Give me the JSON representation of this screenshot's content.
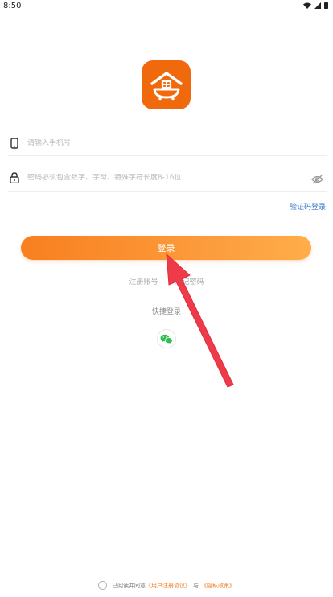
{
  "status_bar": {
    "time": "8:50"
  },
  "form": {
    "phone_placeholder": "请输入手机号",
    "password_placeholder": "密码必须包含数字、字母、特殊字符长度8-16位",
    "sms_login_link": "验证码登录",
    "login_button": "登录",
    "register_link": "注册账号",
    "forgot_password_link": "忘记密码"
  },
  "quick_login": {
    "label": "快捷登录",
    "icon": "wechat-icon"
  },
  "agreement": {
    "prefix": "已阅读并同意",
    "user_agreement": "《用户注册协议》",
    "conjunction": "与",
    "privacy_policy": "《隐私政策》"
  },
  "colors": {
    "brand_orange": "#f06a0d",
    "button_gradient_start": "#f87f1f",
    "button_gradient_end": "#ffad4a",
    "link_blue": "#3b7ac9",
    "wechat_green": "#2dbd4f",
    "annotation_arrow": "#ee3b4a"
  }
}
